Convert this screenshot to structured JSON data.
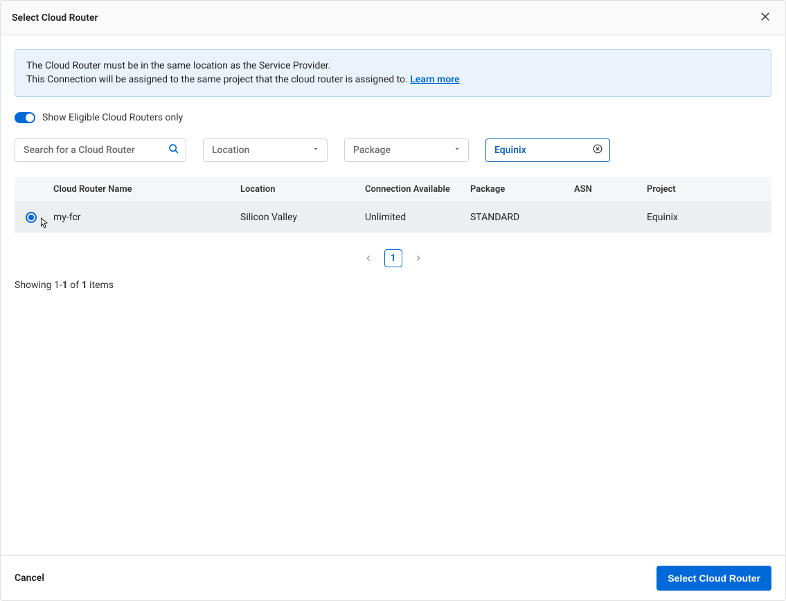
{
  "modal": {
    "title": "Select Cloud Router",
    "banner_line1": "The Cloud Router must be in the same location as the Service Provider.",
    "banner_line2": "This Connection will be assigned to the same project that the cloud router is assigned to. ",
    "banner_link": "Learn more",
    "toggle_label": "Show Eligible Cloud Routers only",
    "search_placeholder": "Search for a Cloud Router",
    "location_label": "Location",
    "package_label": "Package",
    "project_value": "Equinix",
    "table_headers": {
      "col1": "Cloud Router Name",
      "col2": "Location",
      "col3": "Connection Available",
      "col4": "Package",
      "col5": "ASN",
      "col6": "Project"
    },
    "rows": [
      {
        "name": "my-fcr",
        "location": "Silicon Valley",
        "connection": "Unlimited",
        "package": "STANDARD",
        "asn": "",
        "project": "Equinix"
      }
    ],
    "pagination": {
      "page1": "1"
    },
    "showing_prefix": "Showing ",
    "showing_range": "1-1",
    "showing_of": " of ",
    "showing_total": "1",
    "showing_items": " items",
    "cancel_label": "Cancel",
    "select_label": "Select Cloud Router"
  }
}
